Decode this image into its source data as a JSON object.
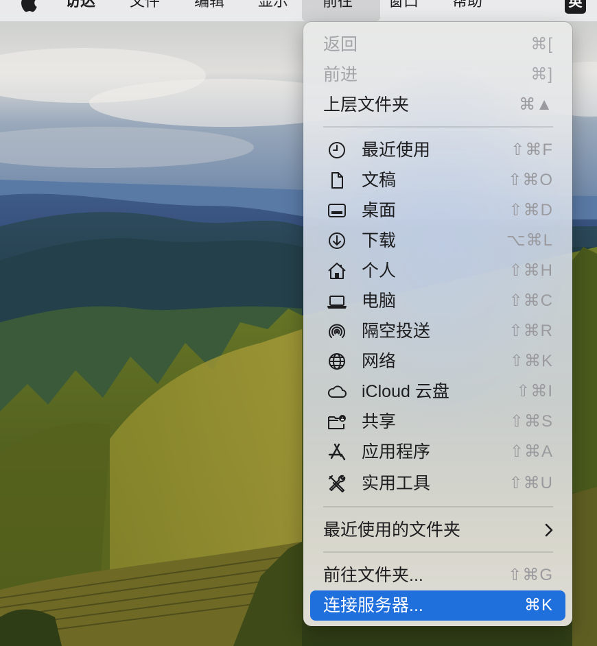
{
  "menubar": {
    "app_name": "访达",
    "items": [
      "文件",
      "编辑",
      "显示",
      "前往",
      "窗口",
      "帮助"
    ],
    "active_item": "前往",
    "input_method": "英"
  },
  "go_menu": {
    "history": [
      {
        "label": "返回",
        "shortcut": "⌘[",
        "enabled": false
      },
      {
        "label": "前进",
        "shortcut": "⌘]",
        "enabled": false
      },
      {
        "label": "上层文件夹",
        "shortcut": "⌘▲",
        "enabled": true
      }
    ],
    "locations": [
      {
        "label": "最近使用",
        "shortcut": "⇧⌘F",
        "icon": "clock-icon"
      },
      {
        "label": "文稿",
        "shortcut": "⇧⌘O",
        "icon": "document-icon"
      },
      {
        "label": "桌面",
        "shortcut": "⇧⌘D",
        "icon": "desktop-icon"
      },
      {
        "label": "下载",
        "shortcut": "⌥⌘L",
        "icon": "download-icon"
      },
      {
        "label": "个人",
        "shortcut": "⇧⌘H",
        "icon": "home-icon"
      },
      {
        "label": "电脑",
        "shortcut": "⇧⌘C",
        "icon": "laptop-icon"
      },
      {
        "label": "隔空投送",
        "shortcut": "⇧⌘R",
        "icon": "airdrop-icon"
      },
      {
        "label": "网络",
        "shortcut": "⇧⌘K",
        "icon": "globe-icon"
      },
      {
        "label": "iCloud 云盘",
        "shortcut": "⇧⌘I",
        "icon": "cloud-icon"
      },
      {
        "label": "共享",
        "shortcut": "⇧⌘S",
        "icon": "shared-folder-icon"
      },
      {
        "label": "应用程序",
        "shortcut": "⇧⌘A",
        "icon": "applications-icon"
      },
      {
        "label": "实用工具",
        "shortcut": "⇧⌘U",
        "icon": "utilities-icon"
      }
    ],
    "recent_folders": {
      "label": "最近使用的文件夹",
      "has_submenu": true
    },
    "goto_folder": {
      "label": "前往文件夹...",
      "shortcut": "⇧⌘G"
    },
    "connect_server": {
      "label": "连接服务器...",
      "shortcut": "⌘K",
      "highlighted": true
    }
  },
  "colors": {
    "highlight": "#1f6fdd",
    "menu_text": "#1d1d1f",
    "disabled_text": "#a4a4a8",
    "shortcut_text": "#9a9a9e"
  }
}
